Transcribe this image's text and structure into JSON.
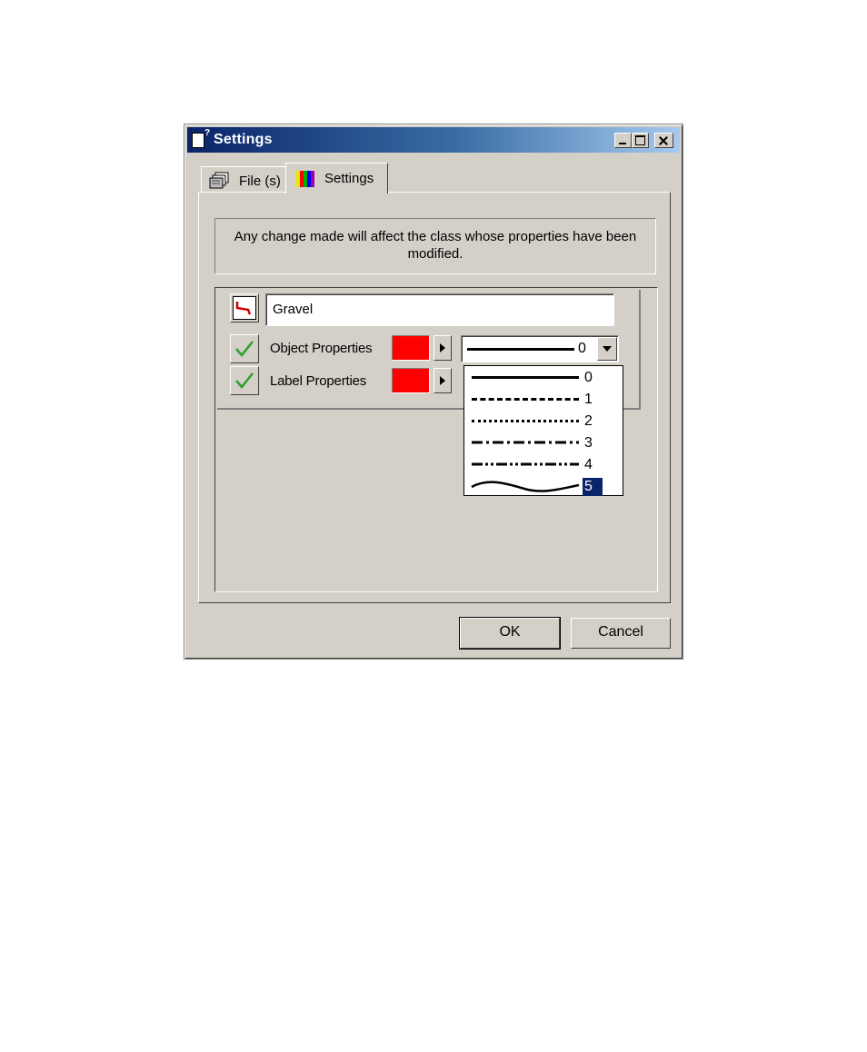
{
  "window": {
    "title": "Settings"
  },
  "tabs": [
    {
      "label": "File (s)",
      "icon": "files-icon"
    },
    {
      "label": "Settings",
      "icon": "color-bars-icon",
      "active": true
    }
  ],
  "info_text": "Any change made will affect the class whose properties have been modified.",
  "class_row": {
    "name": "Gravel",
    "object_properties_label": "Object Properties",
    "label_properties_label": "Label Properties",
    "object_color": "#ff0000",
    "label_color": "#ff0000",
    "object_checked": true,
    "label_checked": true,
    "line_style_selected": "0"
  },
  "line_style_options": [
    {
      "value": "0",
      "style": "solid"
    },
    {
      "value": "1",
      "style": "dashed"
    },
    {
      "value": "2",
      "style": "dotted"
    },
    {
      "value": "3",
      "style": "dash-dot"
    },
    {
      "value": "4",
      "style": "dash-dot-dot"
    },
    {
      "value": "5",
      "style": "wavy",
      "highlighted": true
    }
  ],
  "buttons": {
    "ok": "OK",
    "cancel": "Cancel"
  },
  "colors": {
    "titlebar_start": "#0a246a",
    "titlebar_end": "#a6caf0",
    "dialog_face": "#d4d0c8",
    "check_green": "#2e9e2e",
    "selection": "#0a246a"
  }
}
